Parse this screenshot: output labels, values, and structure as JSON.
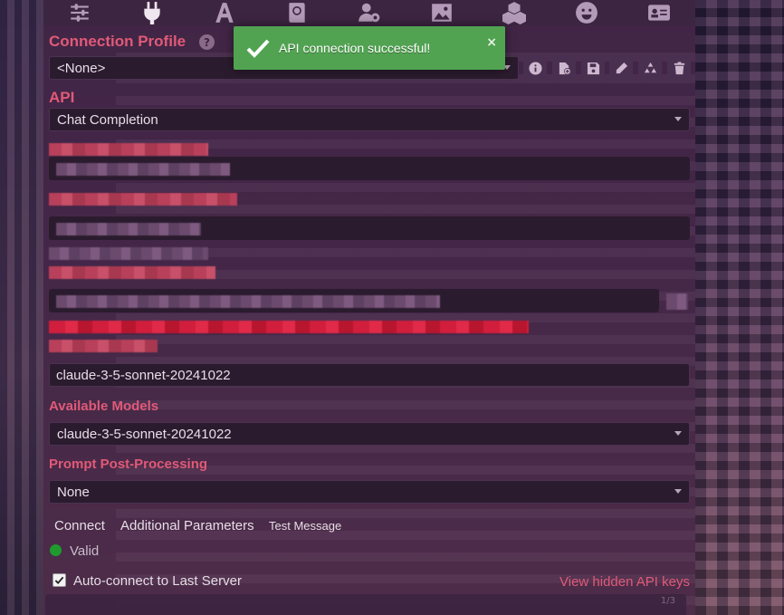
{
  "topbar": {
    "icons": [
      "sliders-icon",
      "plug-icon",
      "font-icon",
      "book-globe-icon",
      "user-gear-icon",
      "image-icon",
      "cubes-icon",
      "smiley-icon",
      "id-card-icon"
    ]
  },
  "connection_profile": {
    "title": "Connection Profile",
    "help": "?",
    "selected": "<None>"
  },
  "toast": {
    "message": "API connection successful!",
    "close": "×",
    "color": "#51a351"
  },
  "api": {
    "title": "API",
    "selected": "Chat Completion"
  },
  "model_input": {
    "value": "claude-3-5-sonnet-20241022"
  },
  "available_models": {
    "title": "Available Models",
    "selected": "claude-3-5-sonnet-20241022"
  },
  "prompt_post_processing": {
    "title": "Prompt Post-Processing",
    "selected": "None"
  },
  "actions": {
    "connect": "Connect",
    "additional_parameters": "Additional Parameters",
    "test_message": "Test Message"
  },
  "status": {
    "text": "Valid",
    "color": "#1f9a2e"
  },
  "auto_connect": {
    "label": "Auto-connect to Last Server",
    "checked": true
  },
  "view_hidden_keys": "View hidden API keys",
  "accent_color": "#e05a78",
  "page_indicator": "1/3"
}
